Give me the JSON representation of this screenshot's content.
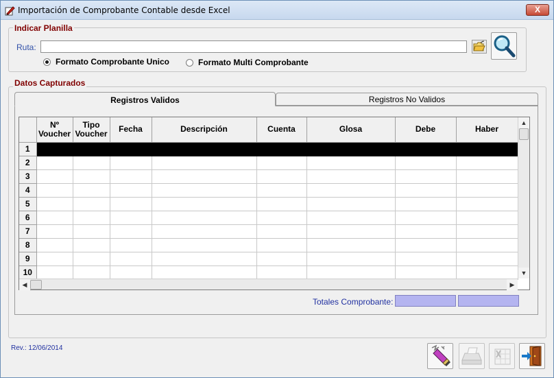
{
  "window": {
    "title": "Importación de Comprobante Contable desde Excel",
    "close_label": "X"
  },
  "planilla": {
    "group_label": "Indicar Planilla",
    "ruta_label": "Ruta:",
    "ruta_value": "",
    "radio_unico": "Formato Comprobante Unico",
    "radio_multi": "Formato Multi Comprobante",
    "selected": "unico"
  },
  "capturados": {
    "group_label": "Datos Capturados",
    "tabs": [
      {
        "label": "Registros Validos",
        "active": true
      },
      {
        "label": "Registros No Validos",
        "active": false
      }
    ],
    "columns": [
      {
        "line1": "Nº",
        "line2": "Voucher"
      },
      {
        "line1": "Tipo",
        "line2": "Voucher"
      },
      {
        "line1": "Fecha",
        "line2": ""
      },
      {
        "line1": "Descripción",
        "line2": ""
      },
      {
        "line1": "Cuenta",
        "line2": ""
      },
      {
        "line1": "Glosa",
        "line2": ""
      },
      {
        "line1": "Debe",
        "line2": ""
      },
      {
        "line1": "Haber",
        "line2": ""
      }
    ],
    "rows": [
      "1",
      "2",
      "3",
      "4",
      "5",
      "6",
      "7",
      "8",
      "9",
      "10"
    ],
    "selected_row": "1",
    "totales_label": "Totales Comprobante:",
    "total_debe": "",
    "total_haber": ""
  },
  "footer": {
    "revision": "Rev.: 12/06/2014"
  },
  "icons": {
    "app": "app-edit-icon",
    "folder": "open-folder-icon",
    "search": "magnifier-icon",
    "clean": "eraser-icon",
    "print": "printer-icon",
    "excel": "spreadsheet-icon",
    "exit": "exit-door-icon"
  },
  "colors": {
    "group_label": "#800000",
    "blue_text": "#2030a0",
    "total_box": "#b4b4f0",
    "selected_row": "#000000"
  }
}
